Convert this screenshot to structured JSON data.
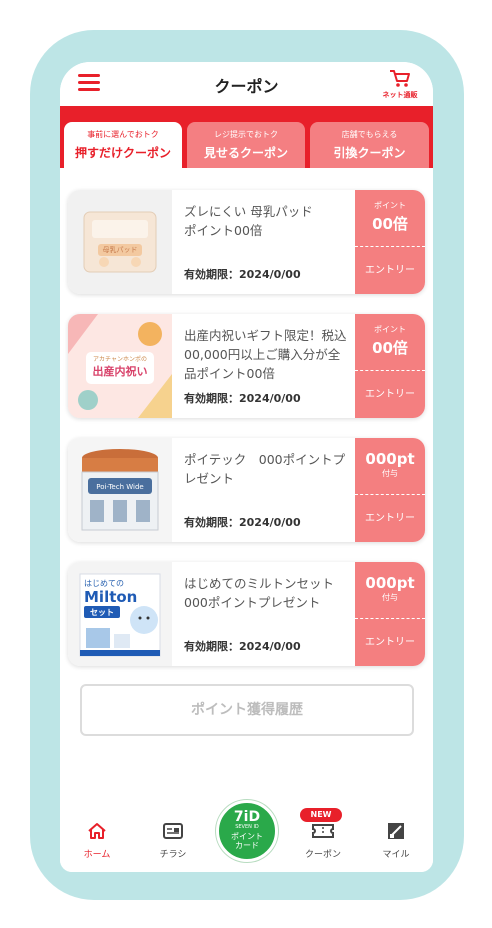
{
  "header": {
    "title": "クーポン",
    "cart_label": "ネット通販"
  },
  "tabs": [
    {
      "sub": "事前に選んでおトク",
      "label": "押すだけクーポン",
      "active": true
    },
    {
      "sub": "レジ提示でおトク",
      "label": "見せるクーポン",
      "active": false
    },
    {
      "sub": "店舗でもらえる",
      "label": "引換クーポン",
      "active": false
    }
  ],
  "coupons": [
    {
      "title": "ズレにくい 母乳パッド\nポイント00倍",
      "expiry": "有効期限：2024/0/00",
      "side_small": "ポイント",
      "side_big": "00倍",
      "side_fuyo": "",
      "entry": "エントリー",
      "image_icon": "breast-pad-package-image"
    },
    {
      "title": "出産内祝いギフト限定！税込00,000円以上ご購入分が全品ポイント00倍",
      "expiry": "有効期限：2024/0/00",
      "side_small": "ポイント",
      "side_big": "00倍",
      "side_fuyo": "",
      "entry": "エントリー",
      "image_icon": "birth-gift-banner-image",
      "image_text_1": "出産内祝い",
      "image_text_2": "アカチャンホンポの"
    },
    {
      "title": "ポイテック　000ポイントプレゼント",
      "expiry": "有効期限：2024/0/00",
      "side_small": "",
      "side_big": "000pt",
      "side_fuyo": "付与",
      "entry": "エントリー",
      "image_icon": "poi-tech-bin-image",
      "image_text_1": "Poi-Tech Wide"
    },
    {
      "title": "はじめてのミルトンセット 000ポイントプレゼント",
      "expiry": "有効期限：2024/0/00",
      "side_small": "",
      "side_big": "000pt",
      "side_fuyo": "付与",
      "entry": "エントリー",
      "image_icon": "milton-set-image",
      "image_text_1": "はじめての",
      "image_text_2": "Milton",
      "image_text_3": "セット"
    }
  ],
  "history_button": "ポイント獲得履歴",
  "bottom_nav": {
    "home": "ホーム",
    "flyer": "チラシ",
    "point_card_logo": "7iD",
    "point_card_brand": "SEVEN ID",
    "point_card_label_1": "ポイント",
    "point_card_label_2": "カード",
    "coupon": "クーポン",
    "coupon_badge": "NEW",
    "mile": "マイル"
  },
  "colors": {
    "accent": "#e8202a",
    "coupon_side": "#f47f80",
    "frame": "#bde5e6",
    "point_card": "#2aa94a"
  }
}
